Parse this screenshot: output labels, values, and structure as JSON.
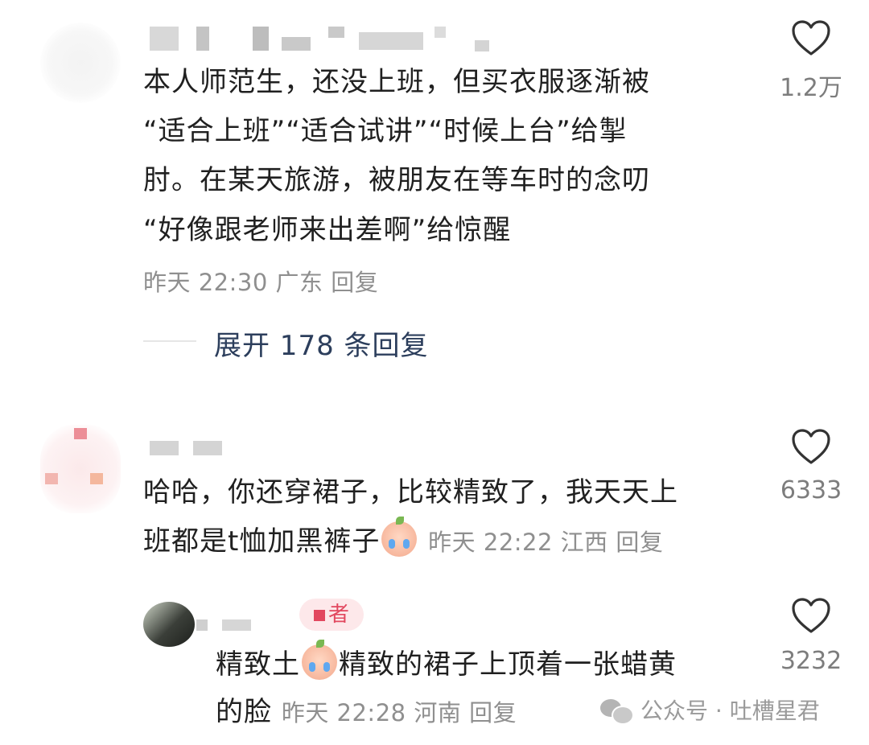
{
  "comments": [
    {
      "text_lines": [
        "本人师范生，还没上班，但买衣服逐渐被",
        "“适合上班”“适合试讲”“时候上台”给掣",
        "肘。在某天旅游，被朋友在等车时的念叨",
        "“好像跟老师来出差啊”给惊醒"
      ],
      "time": "昨天 22:30",
      "location": "广东",
      "reply_label": "回复",
      "likes": "1.2万",
      "expand_label": "展开 178 条回复"
    },
    {
      "text_line1": "哈哈，你还穿裙子，比较精致了，我天天上",
      "text_line2": "班都是t恤加黑裤子",
      "time": "昨天 22:22",
      "location": "江西",
      "reply_label": "回复",
      "likes": "6333"
    },
    {
      "author_badge": "者",
      "text_line1_a": "精致土",
      "text_line1_b": "精致的裙子上顶着一张蜡黄",
      "text_line2": "的脸",
      "time": "昨天 22:28",
      "location": "河南",
      "reply_label": "回复",
      "likes": "3232"
    }
  ],
  "watermark": "公众号 · 吐槽星君",
  "icons": {
    "like": "heart-outline-icon",
    "emoji": "crying-face-emoji",
    "wechat": "wechat-icon"
  }
}
